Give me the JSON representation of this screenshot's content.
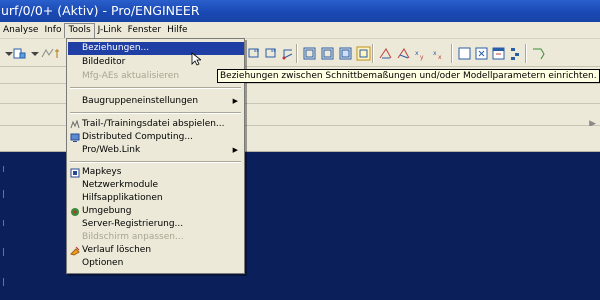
{
  "window": {
    "title": "urf/0/0+ (Aktiv) - Pro/ENGINEER"
  },
  "menubar": {
    "items": [
      {
        "label": "Analyse"
      },
      {
        "label": "Info"
      },
      {
        "label": "Tools"
      },
      {
        "label": "J-Link"
      },
      {
        "label": "Fenster"
      },
      {
        "label": "Hilfe"
      }
    ]
  },
  "tools_menu": {
    "items": [
      {
        "label": "Beziehungen..."
      },
      {
        "label": "Bildeditor"
      },
      {
        "label": "Mfg-AEs aktualisieren"
      },
      {
        "label": "Baugruppeneinstellungen"
      },
      {
        "label": "Trail-/Trainingsdatei abspielen..."
      },
      {
        "label": "Distributed Computing..."
      },
      {
        "label": "Pro/Web.Link"
      },
      {
        "label": "Mapkeys"
      },
      {
        "label": "Netzwerkmodule"
      },
      {
        "label": "Hilfsapplikationen"
      },
      {
        "label": "Umgebung"
      },
      {
        "label": "Server-Registrierung..."
      },
      {
        "label": "Bildschirm anpassen..."
      },
      {
        "label": "Verlauf löschen"
      },
      {
        "label": "Optionen"
      }
    ]
  },
  "tooltip": {
    "text": "Beziehungen zwischen Schnittbemaßungen und/oder Modellparametern einrichten."
  },
  "colors": {
    "titlebar": "#1a49b4",
    "highlight": "#1f3fa5",
    "menu_bg": "#ece9d8",
    "graphics_bg": "#0b1f5a",
    "tooltip_bg": "#ffffe1"
  },
  "icons": [
    "new-icon",
    "open-icon",
    "datum-plane-icon",
    "datum-axis-icon",
    "datum-point-icon",
    "view-icon",
    "sketch-icon",
    "dimension-icon",
    "window-icon",
    "relations-icon",
    "settings-icon",
    "environment-icon",
    "clear-icon"
  ]
}
